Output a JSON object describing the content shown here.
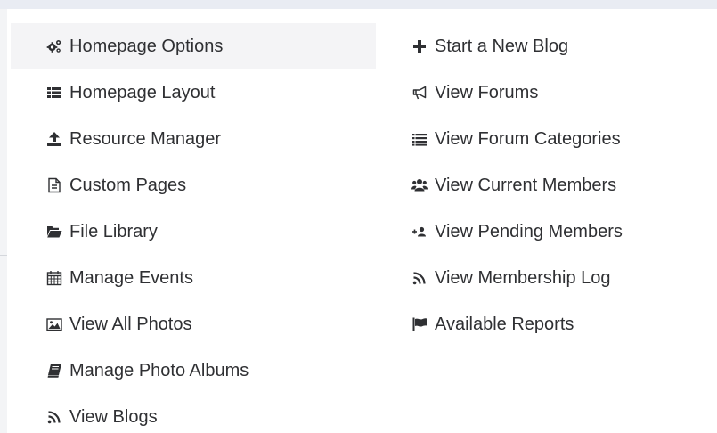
{
  "menu": {
    "left": [
      {
        "label": "Homepage Options",
        "icon": "gears-icon",
        "active": true
      },
      {
        "label": "Homepage Layout",
        "icon": "table-list-icon"
      },
      {
        "label": "Resource Manager",
        "icon": "upload-icon"
      },
      {
        "label": "Custom Pages",
        "icon": "document-icon"
      },
      {
        "label": "File Library",
        "icon": "folder-open-icon"
      },
      {
        "label": "Manage Events",
        "icon": "calendar-icon"
      },
      {
        "label": "View All Photos",
        "icon": "image-icon"
      },
      {
        "label": "Manage Photo Albums",
        "icon": "book-icon"
      },
      {
        "label": "View Blogs",
        "icon": "rss-icon"
      }
    ],
    "right": [
      {
        "label": "Start a New Blog",
        "icon": "plus-icon"
      },
      {
        "label": "View Forums",
        "icon": "bullhorn-icon"
      },
      {
        "label": "View Forum Categories",
        "icon": "list-icon"
      },
      {
        "label": "View Current Members",
        "icon": "users-icon"
      },
      {
        "label": "View Pending Members",
        "icon": "user-plus-icon"
      },
      {
        "label": "View Membership Log",
        "icon": "rss-icon"
      },
      {
        "label": "Available Reports",
        "icon": "flag-icon"
      }
    ]
  },
  "colors": {
    "text": "#2f3033",
    "icon": "#2f3033",
    "active_background": "#f4f4f6",
    "top_bar": "#e9ecf3"
  }
}
